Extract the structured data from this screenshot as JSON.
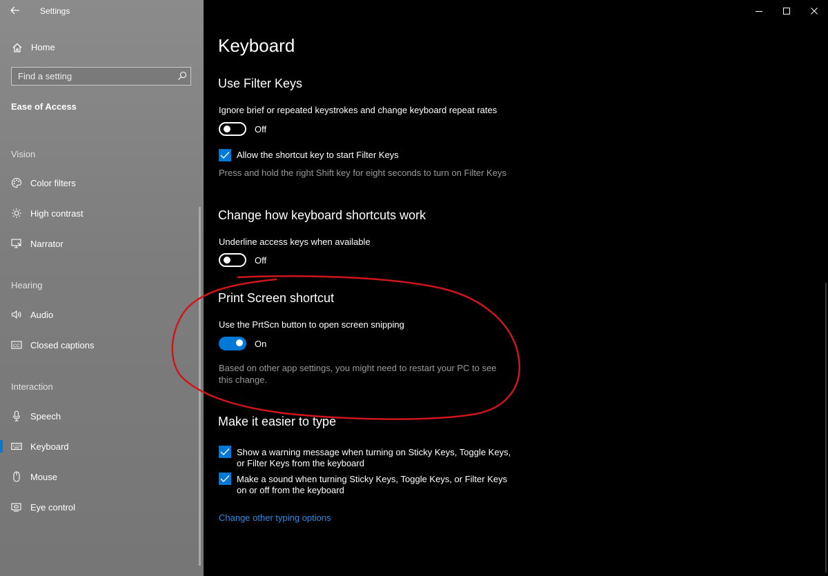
{
  "window": {
    "title": "Settings"
  },
  "sidebar": {
    "home_label": "Home",
    "search_placeholder": "Find a setting",
    "section_title": "Ease of Access",
    "groups": {
      "vision": "Vision",
      "hearing": "Hearing",
      "interaction": "Interaction"
    },
    "items": [
      {
        "label": "Color filters",
        "icon": "color-palette-icon"
      },
      {
        "label": "High contrast",
        "icon": "brightness-icon"
      },
      {
        "label": "Narrator",
        "icon": "narrator-icon"
      },
      {
        "label": "Audio",
        "icon": "speaker-icon"
      },
      {
        "label": "Closed captions",
        "icon": "cc-icon"
      },
      {
        "label": "Speech",
        "icon": "microphone-icon"
      },
      {
        "label": "Keyboard",
        "icon": "keyboard-icon",
        "selected": true
      },
      {
        "label": "Mouse",
        "icon": "mouse-icon"
      },
      {
        "label": "Eye control",
        "icon": "eye-control-icon"
      }
    ]
  },
  "main": {
    "page_title": "Keyboard",
    "filter_keys": {
      "heading": "Use Filter Keys",
      "desc": "Ignore brief or repeated keystrokes and change keyboard repeat rates",
      "toggle_state": "Off",
      "checkbox_label": "Allow the shortcut key to start Filter Keys",
      "checkbox_checked": true,
      "hint": "Press and hold the right Shift key for eight seconds to turn on Filter Keys"
    },
    "shortcuts": {
      "heading": "Change how keyboard shortcuts work",
      "desc": "Underline access keys when available",
      "toggle_state": "Off"
    },
    "print_screen": {
      "heading": "Print Screen shortcut",
      "desc": "Use the PrtScn button to open screen snipping",
      "toggle_state": "On",
      "note_line1": "Based on other app settings, you might need to restart your PC to see",
      "note_line2": "this change."
    },
    "easier_to_type": {
      "heading": "Make it easier to type",
      "checkbox1_line1": "Show a warning message when turning on Sticky Keys, Toggle Keys,",
      "checkbox1_line2": "or Filter Keys from the keyboard",
      "checkbox2_line1": "Make a sound when turning Sticky Keys, Toggle Keys, or Filter Keys",
      "checkbox2_line2": "on or off from the keyboard",
      "link": "Change other typing options"
    }
  },
  "colors": {
    "accent": "#0078d7",
    "link": "#2d8ce3",
    "annotation": "#d0161b",
    "sidebar_bg": "#808080",
    "main_bg": "#000000"
  }
}
